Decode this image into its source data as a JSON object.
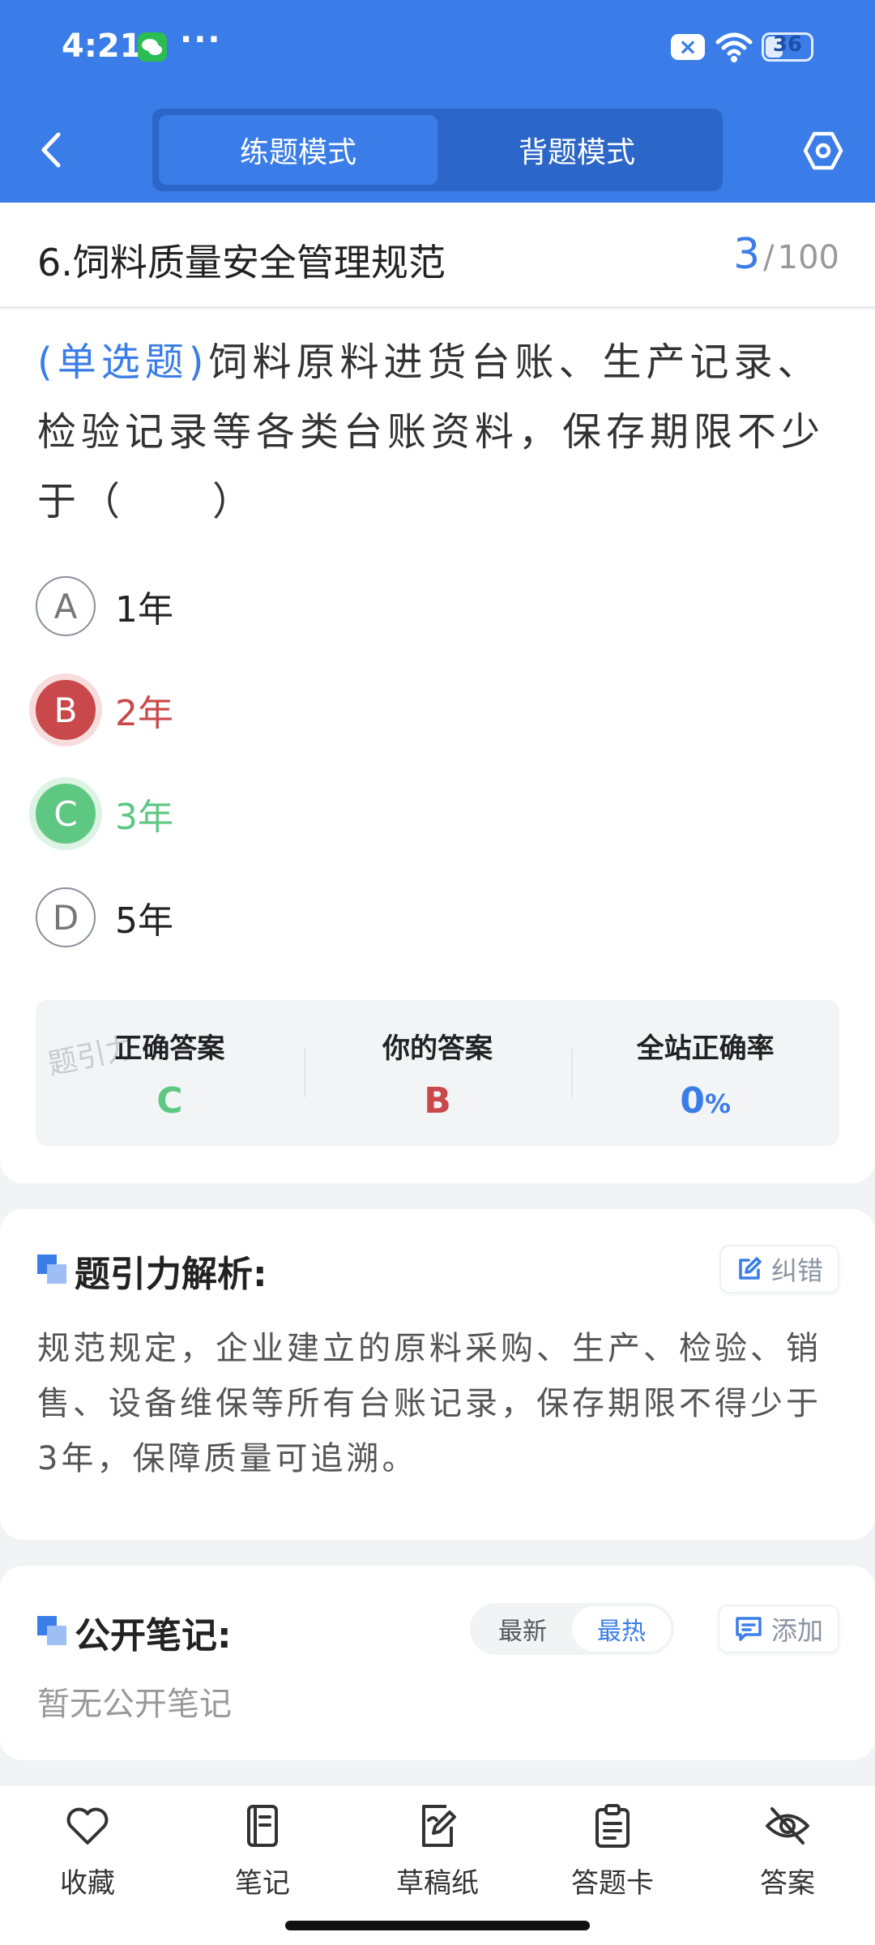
{
  "status_bar": {
    "time": "4:21",
    "dots": "···",
    "battery": "36",
    "icons": [
      "wechat-icon",
      "close-box-icon",
      "wifi-icon",
      "battery-icon"
    ]
  },
  "header": {
    "modes": [
      {
        "label": "练题模式",
        "active": true
      },
      {
        "label": "背题模式",
        "active": false
      }
    ],
    "icons": [
      "back-icon",
      "settings-icon"
    ],
    "accent_color": "#3b7de8"
  },
  "title_bar": {
    "chapter": "6.饲料质量安全管理规范",
    "current": "3",
    "separator": "/",
    "total": "100"
  },
  "question": {
    "type": "(单选题)",
    "text": "饲料原料进货台账、生产记录、检验记录等各类台账资料，保存期限不少于（　　）",
    "options": [
      {
        "letter": "A",
        "text": "1年",
        "state": "normal"
      },
      {
        "letter": "B",
        "text": "2年",
        "state": "wrong"
      },
      {
        "letter": "C",
        "text": "3年",
        "state": "correct"
      },
      {
        "letter": "D",
        "text": "5年",
        "state": "normal"
      }
    ]
  },
  "answer_summary": {
    "watermark": "题引力",
    "correct_label": "正确答案",
    "correct_value": "C",
    "yours_label": "你的答案",
    "yours_value": "B",
    "rate_label": "全站正确率",
    "rate_value": "0",
    "rate_unit": "%",
    "colors": {
      "correct": "#5ec883",
      "wrong": "#c9484b",
      "rate": "#3b7de8"
    }
  },
  "analysis": {
    "title": "题引力解析:",
    "report_label": "纠错",
    "text": "规范规定，企业建立的原料采购、生产、检验、销售、设备维保等所有台账记录，保存期限不得少于3年，保障质量可追溯。"
  },
  "notes": {
    "title": "公开笔记:",
    "sort_options": [
      {
        "label": "最新",
        "active": false
      },
      {
        "label": "最热",
        "active": true
      }
    ],
    "add_label": "添加",
    "empty_text": "暂无公开笔记"
  },
  "bottom_bar": [
    {
      "label": "收藏",
      "icon": "heart-icon"
    },
    {
      "label": "笔记",
      "icon": "notebook-icon"
    },
    {
      "label": "草稿纸",
      "icon": "draft-icon"
    },
    {
      "label": "答题卡",
      "icon": "answer-sheet-icon"
    },
    {
      "label": "答案",
      "icon": "eye-off-icon"
    }
  ]
}
